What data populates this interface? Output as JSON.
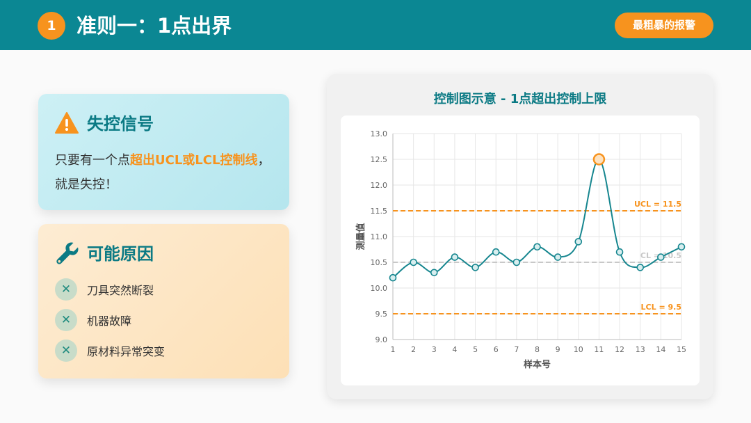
{
  "header": {
    "number": "1",
    "title": "准则一：1点出界",
    "pill": "最粗暴的报警"
  },
  "signal_card": {
    "icon": "warning-triangle-icon",
    "title": "失控信号",
    "text_before": "只要有一个点",
    "text_highlight": "超出UCL或LCL控制线",
    "text_after": "，就是失控！"
  },
  "causes_card": {
    "icon": "wrench-icon",
    "title": "可能原因",
    "items": [
      {
        "icon": "close-icon",
        "label": "刀具突然断裂"
      },
      {
        "icon": "close-icon",
        "label": "机器故障"
      },
      {
        "icon": "close-icon",
        "label": "原材料异常突变"
      }
    ]
  },
  "colors": {
    "teal": "#0b8793",
    "orange": "#f7931e",
    "line": "#16868f",
    "cl": "#c8c8c8"
  },
  "chart_data": {
    "type": "line",
    "title": "控制图示意 - 1点超出控制上限",
    "xlabel": "样本号",
    "ylabel": "测量值",
    "x": [
      1,
      2,
      3,
      4,
      5,
      6,
      7,
      8,
      9,
      10,
      11,
      12,
      13,
      14,
      15
    ],
    "values": [
      10.2,
      10.5,
      10.3,
      10.6,
      10.4,
      10.7,
      10.5,
      10.8,
      10.6,
      10.9,
      12.5,
      10.7,
      10.4,
      10.6,
      10.8
    ],
    "ylim": [
      9.0,
      13.0
    ],
    "yticks": [
      9.0,
      9.5,
      10.0,
      10.5,
      11.0,
      11.5,
      12.0,
      12.5,
      13.0
    ],
    "grid": true,
    "smooth": true,
    "out_of_control_point": 11,
    "limits": [
      {
        "label": "UCL = 11.5",
        "value": 11.5,
        "color": "#f7931e"
      },
      {
        "label": "CL = 10.5",
        "value": 10.5,
        "color": "#c8c8c8"
      },
      {
        "label": "LCL = 9.5",
        "value": 9.5,
        "color": "#f7931e"
      }
    ]
  }
}
